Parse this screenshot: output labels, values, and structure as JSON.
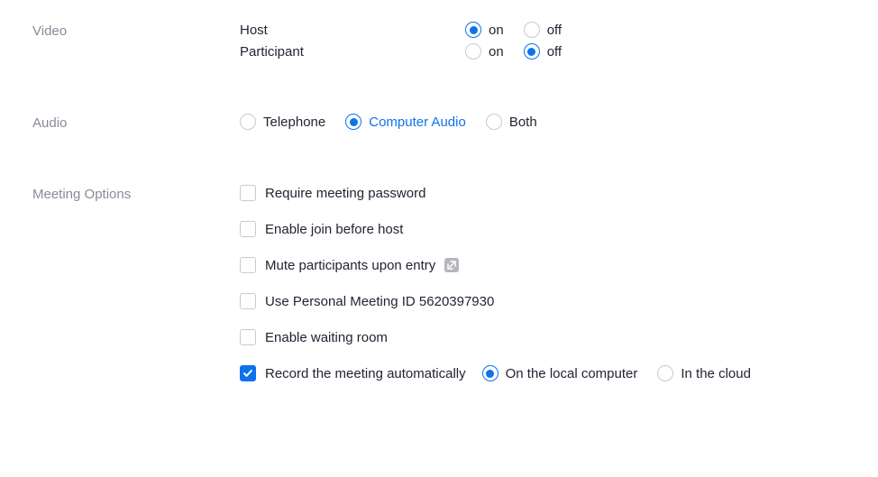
{
  "colors": {
    "accent": "#0e72ed",
    "muted": "#8a8a98"
  },
  "video": {
    "section_label": "Video",
    "host_label": "Host",
    "participant_label": "Participant",
    "on_label": "on",
    "off_label": "off",
    "host_value": "on",
    "participant_value": "off"
  },
  "audio": {
    "section_label": "Audio",
    "options": {
      "telephone": "Telephone",
      "computer": "Computer Audio",
      "both": "Both"
    },
    "value": "computer"
  },
  "meeting_options": {
    "section_label": "Meeting Options",
    "require_password": {
      "label": "Require meeting password",
      "checked": false
    },
    "join_before_host": {
      "label": "Enable join before host",
      "checked": false
    },
    "mute_on_entry": {
      "label": "Mute participants upon entry",
      "checked": false
    },
    "use_pmi": {
      "label": "Use Personal Meeting ID 5620397930",
      "checked": false
    },
    "waiting_room": {
      "label": "Enable waiting room",
      "checked": false
    },
    "auto_record": {
      "label": "Record the meeting automatically",
      "checked": true,
      "location": "local",
      "local_label": "On the local computer",
      "cloud_label": "In the cloud"
    }
  }
}
